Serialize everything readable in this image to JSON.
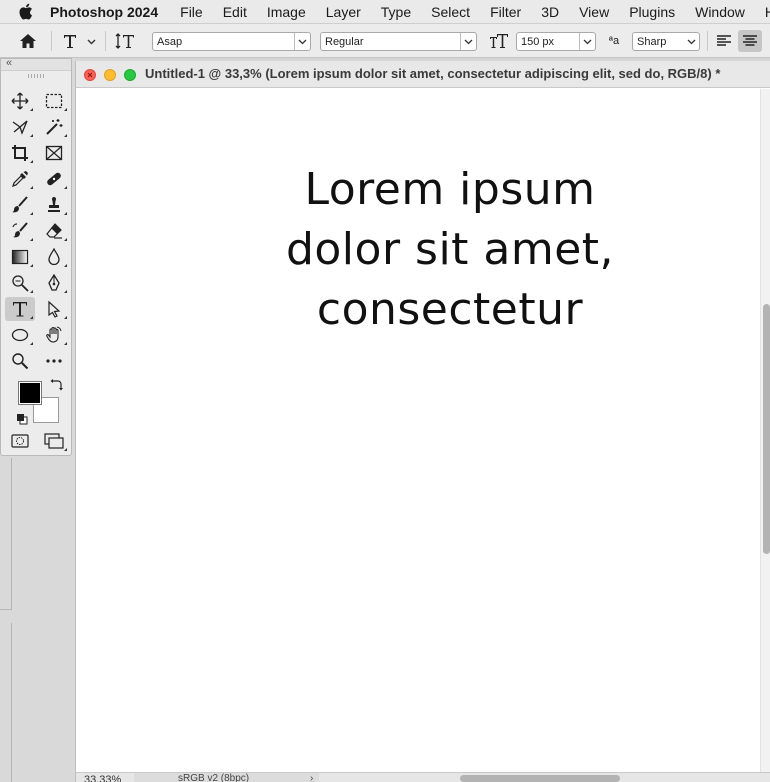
{
  "menubar": {
    "app_name": "Photoshop 2024",
    "items": [
      "File",
      "Edit",
      "Image",
      "Layer",
      "Type",
      "Select",
      "Filter",
      "3D",
      "View",
      "Plugins",
      "Window",
      "H"
    ]
  },
  "options": {
    "font_family": "Asap",
    "font_style": "Regular",
    "font_size": "150 px",
    "antialias_icon_label": "ªa",
    "antialias": "Sharp"
  },
  "document": {
    "title": "Untitled-1 @ 33,3% (Lorem ipsum dolor sit amet, consectetur adipiscing elit, sed do, RGB/8) *",
    "canvas_lines": [
      "Lorem ipsum",
      "dolor sit amet,",
      "consectetur"
    ]
  },
  "status": {
    "zoom": "33,33%",
    "profile": "sRGB v2 (8bpc)",
    "more": "›"
  },
  "colors": {
    "foreground": "#000000",
    "background": "#ffffff",
    "close": "#ff5f57",
    "minimize": "#febc2e",
    "zoom": "#28c840"
  }
}
